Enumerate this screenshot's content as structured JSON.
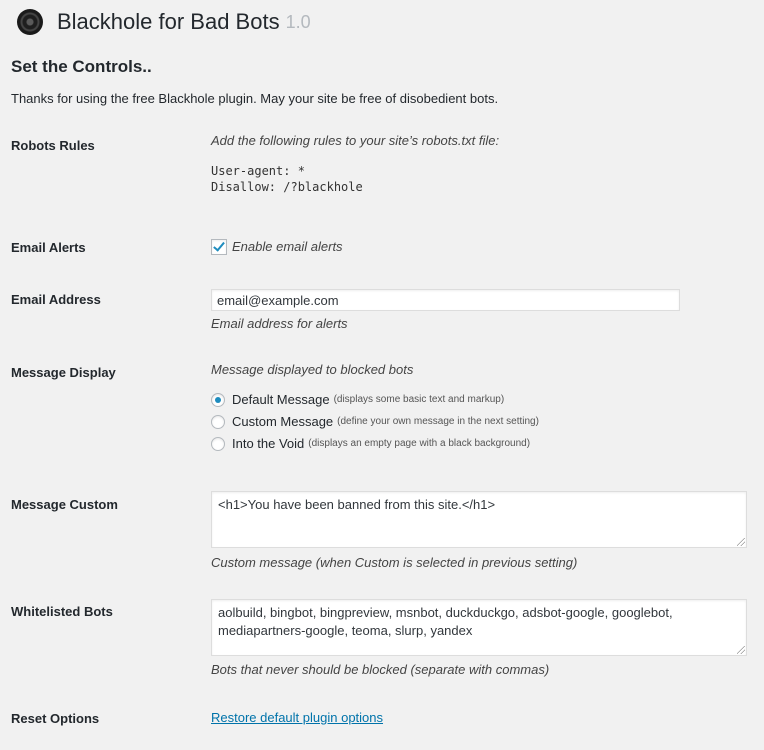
{
  "header": {
    "title": "Blackhole for Bad Bots",
    "version": "1.0"
  },
  "section_title": "Set the Controls..",
  "intro": "Thanks for using the free Blackhole plugin. May your site be free of disobedient bots.",
  "robots": {
    "label": "Robots Rules",
    "desc": "Add the following rules to your site’s robots.txt file:",
    "code_line1": "User-agent: *",
    "code_line2": "Disallow: /?blackhole"
  },
  "email_alerts": {
    "label": "Email Alerts",
    "checkbox_label": "Enable email alerts",
    "checked": true
  },
  "email_address": {
    "label": "Email Address",
    "value": "email@example.com",
    "desc": "Email address for alerts"
  },
  "message_display": {
    "label": "Message Display",
    "desc": "Message displayed to blocked bots",
    "options": [
      {
        "label": "Default Message",
        "note": "(displays some basic text and markup)",
        "checked": true
      },
      {
        "label": "Custom Message",
        "note": "(define your own message in the next setting)",
        "checked": false
      },
      {
        "label": "Into the Void",
        "note": "(displays an empty page with a black background)",
        "checked": false
      }
    ]
  },
  "message_custom": {
    "label": "Message Custom",
    "value": "<h1>You have been banned from this site.</h1>",
    "desc": "Custom message (when Custom is selected in previous setting)"
  },
  "whitelisted": {
    "label": "Whitelisted Bots",
    "value_line1": "aolbuild, bingbot, bingpreview, msnbot, duckduckgo, adsbot-google, googlebot,",
    "value_line2": "mediapartners-google, teoma, slurp, yandex",
    "desc": "Bots that never should be blocked (separate with commas)"
  },
  "reset": {
    "label": "Reset Options",
    "link": "Restore default plugin options"
  },
  "colors": {
    "accent": "#1e8cbe",
    "link": "#0073aa",
    "background": "#f1f1f1"
  }
}
